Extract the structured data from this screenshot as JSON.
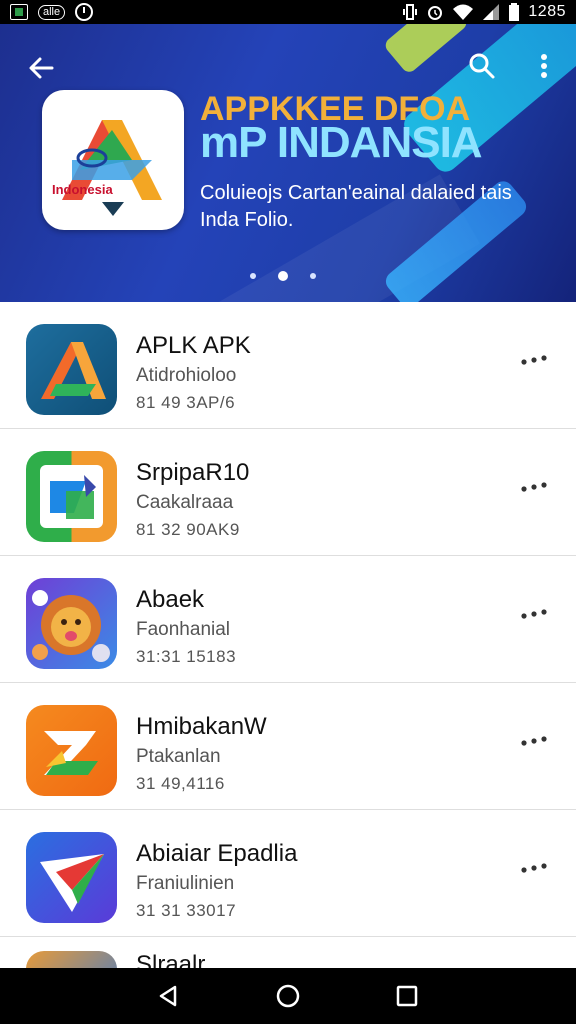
{
  "status_bar": {
    "notification_pill": "alle",
    "time": "1285"
  },
  "banner": {
    "logo_text": "Indonesia",
    "title_line1": "APPKKEE DFOA",
    "title_line2": "mP INDANSIA",
    "subtitle": "Coluieojs Cartan'eainal dalaied tais Inda Folio.",
    "page_count": 3,
    "active_page": 2,
    "colors": {
      "title1": "#f2b03a",
      "title2": "#8fe3ff",
      "background": "#2443b8"
    }
  },
  "toolbar": {
    "back_icon": "arrow-left-icon",
    "search_icon": "search-icon",
    "more_icon": "more-vertical-icon"
  },
  "apps": [
    {
      "name": "APLK APK",
      "category": "Atidrohioloo",
      "size": "81 49 3AP/6",
      "icon": "orange-triangle-logo-icon"
    },
    {
      "name": "SrpipaR10",
      "category": "Caakalraaa",
      "size": "81 32 90AK9",
      "icon": "green-orange-square-logo-icon"
    },
    {
      "name": "Abaek",
      "category": "Faonhanial",
      "size": "31:31 15183",
      "icon": "lion-face-icon"
    },
    {
      "name": "HmibakanW",
      "category": "Ptakanlan",
      "size": "31 49,4116",
      "icon": "orange-z-logo-icon"
    },
    {
      "name": "Abiaiar Epadlia",
      "category": "Franiulinien",
      "size": "31 31 33017",
      "icon": "paper-plane-logo-icon"
    }
  ],
  "partial_app": {
    "name": "Slraalr"
  },
  "nav": {
    "back": "triangle-back-icon",
    "home": "circle-home-icon",
    "recents": "square-recents-icon"
  }
}
